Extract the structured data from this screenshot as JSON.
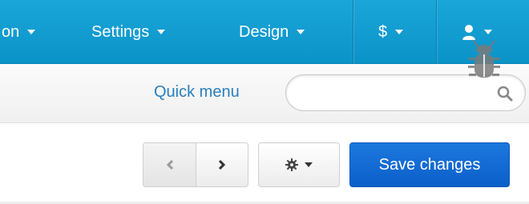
{
  "nav": {
    "items": [
      {
        "label": "on"
      },
      {
        "label": "Settings"
      },
      {
        "label": "Design"
      },
      {
        "label": "$"
      }
    ]
  },
  "subbar": {
    "quick_menu": "Quick menu",
    "search": {
      "placeholder": "",
      "value": ""
    }
  },
  "toolbar": {
    "save_label": "Save changes"
  },
  "colors": {
    "navbar": "#1aa6d8",
    "link": "#2a7fc0",
    "primary_button": "#0b5fc8"
  },
  "icons": [
    "chevron-left-icon",
    "chevron-right-icon",
    "gear-icon",
    "user-icon",
    "bug-icon",
    "search-icon"
  ]
}
